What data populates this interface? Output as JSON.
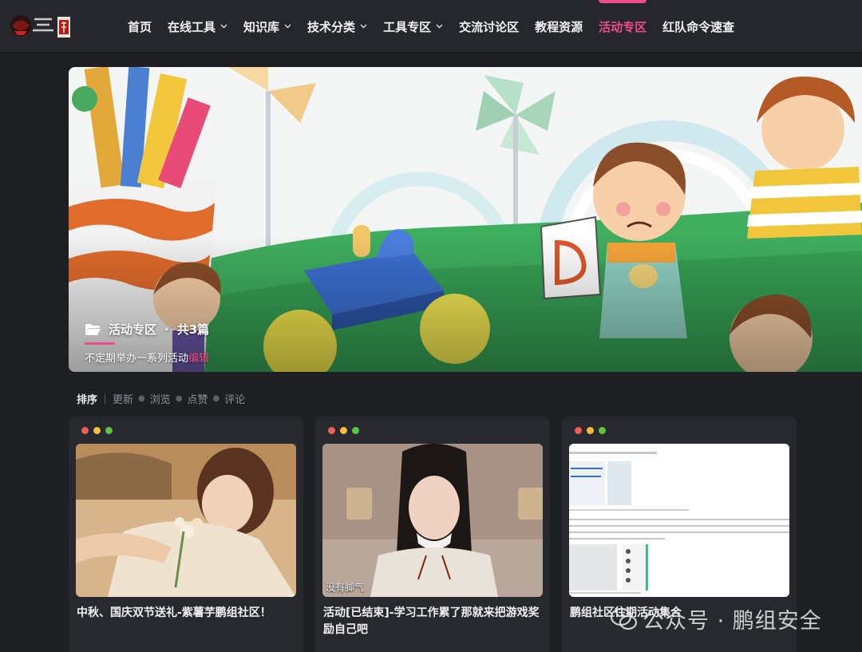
{
  "nav": {
    "items": [
      {
        "label": "首页",
        "dropdown": false,
        "active": false
      },
      {
        "label": "在线工具",
        "dropdown": true,
        "active": false
      },
      {
        "label": "知识库",
        "dropdown": true,
        "active": false
      },
      {
        "label": "技术分类",
        "dropdown": true,
        "active": false
      },
      {
        "label": "工具专区",
        "dropdown": true,
        "active": false
      },
      {
        "label": "交流讨论区",
        "dropdown": false,
        "active": false
      },
      {
        "label": "教程资源",
        "dropdown": false,
        "active": false
      },
      {
        "label": "活动专区",
        "dropdown": false,
        "active": true
      },
      {
        "label": "红队命令速查",
        "dropdown": false,
        "active": false
      }
    ],
    "accent": "#ef4d8a"
  },
  "hero": {
    "category": "活动专区",
    "count": "共3篇",
    "description": "不定期举办一系列活动",
    "edit_label": "编辑"
  },
  "sort": {
    "head": "排序",
    "options": [
      "更新",
      "浏览",
      "点赞",
      "评论"
    ]
  },
  "cards": [
    {
      "title": "中秋、国庆双节送礼-紫薯芋鹏组社区！"
    },
    {
      "title": "活动[已结束]-学习工作累了那就来把游戏奖励自己吧",
      "image_caption": "没有脚气"
    },
    {
      "title": "鹏组社区往期活动集合"
    }
  ],
  "watermark": {
    "text": "公众号 · 鹏组安全"
  }
}
